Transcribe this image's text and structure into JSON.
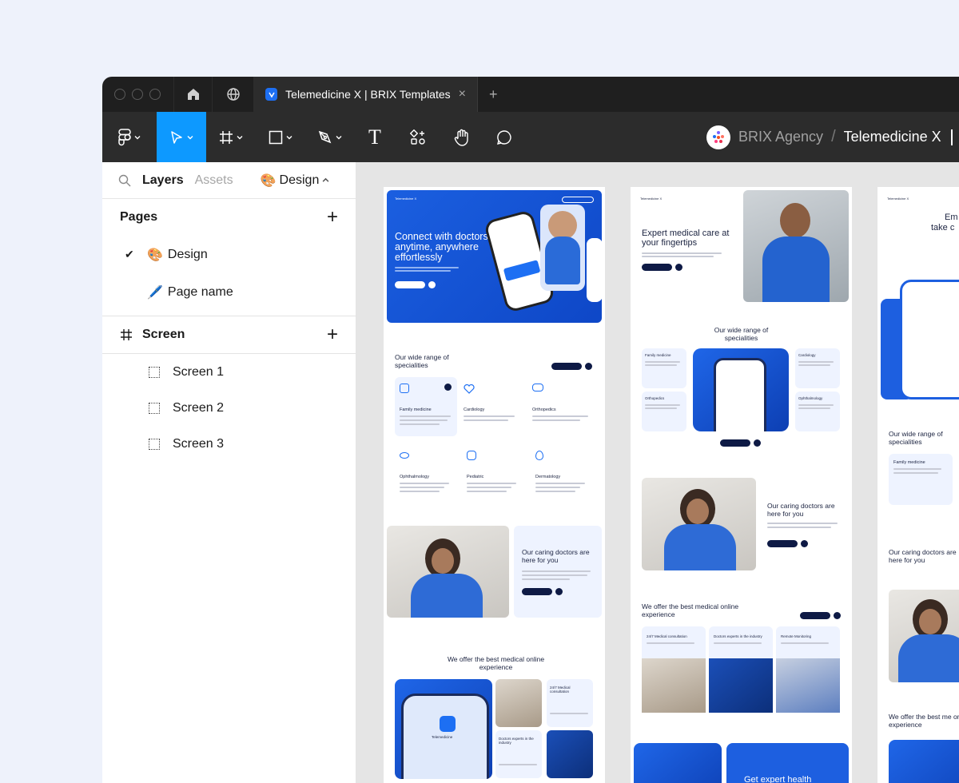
{
  "tabbar": {
    "file_tab_title": "Telemedicine X | BRIX Templates",
    "close_symbol": "×",
    "new_tab_symbol": "+"
  },
  "toolbar": {
    "team_name": "BRIX Agency",
    "separator": "/",
    "file_name": "Telemedicine X",
    "text_tool_glyph": "T"
  },
  "panel": {
    "tabs": {
      "layers": "Layers",
      "assets": "Assets",
      "design": "Design"
    },
    "pages_heading": "Pages",
    "pages": [
      {
        "label": "Design",
        "checked": true,
        "emoji": "🎨"
      },
      {
        "label": "Page name",
        "checked": false,
        "emoji": "🖊️"
      }
    ],
    "screen_heading": "Screen",
    "screens": [
      "Screen 1",
      "Screen 2",
      "Screen 3"
    ],
    "add_symbol": "+"
  },
  "canvas": {
    "board1": {
      "nav_logo": "Telemedicine X",
      "hero_title": "Connect with doctors anytime, anywhere effortlessly",
      "specialities_title": "Our wide range of specialities",
      "specialities": [
        "Family medicine",
        "Cardiology",
        "Orthopedics",
        "Ophthalmology",
        "Pediatric",
        "Dermatology"
      ],
      "doctors_title": "Our caring doctors are here for you",
      "best_title": "We offer the best medical online experience",
      "consult_label": "24/7 Medical consultation",
      "experts_label": "Doctors experts in the industry",
      "app_label": "Telemedicine"
    },
    "board2": {
      "nav_logo": "Telemedicine X",
      "hero_title": "Expert medical care at your fingertips",
      "specialities_title": "Our wide range of specialities",
      "specialities": [
        "Family medicine",
        "Cardiology",
        "Orthopedics",
        "Ophthalmology"
      ],
      "doctors_title": "Our caring doctors are here for you",
      "best_title": "We offer the best medical online experience",
      "features": [
        "24/7 Medical consultation",
        "Doctors experts in the industry",
        "Remote Monitoring"
      ],
      "bottom_title": "Get expert health"
    },
    "board3": {
      "nav_logo": "Telemedicine X",
      "hero_title_1": "Em",
      "hero_title_2": "take c",
      "specialities_title": "Our wide range of specialities",
      "family_label": "Family medicine",
      "doctors_title": "Our caring doctors are here for you",
      "best_title": "We offer the best me online experience"
    }
  },
  "colors": {
    "brand_blue": "#1d6ff3",
    "figma_select": "#0d99ff",
    "navy": "#0e1a45"
  }
}
